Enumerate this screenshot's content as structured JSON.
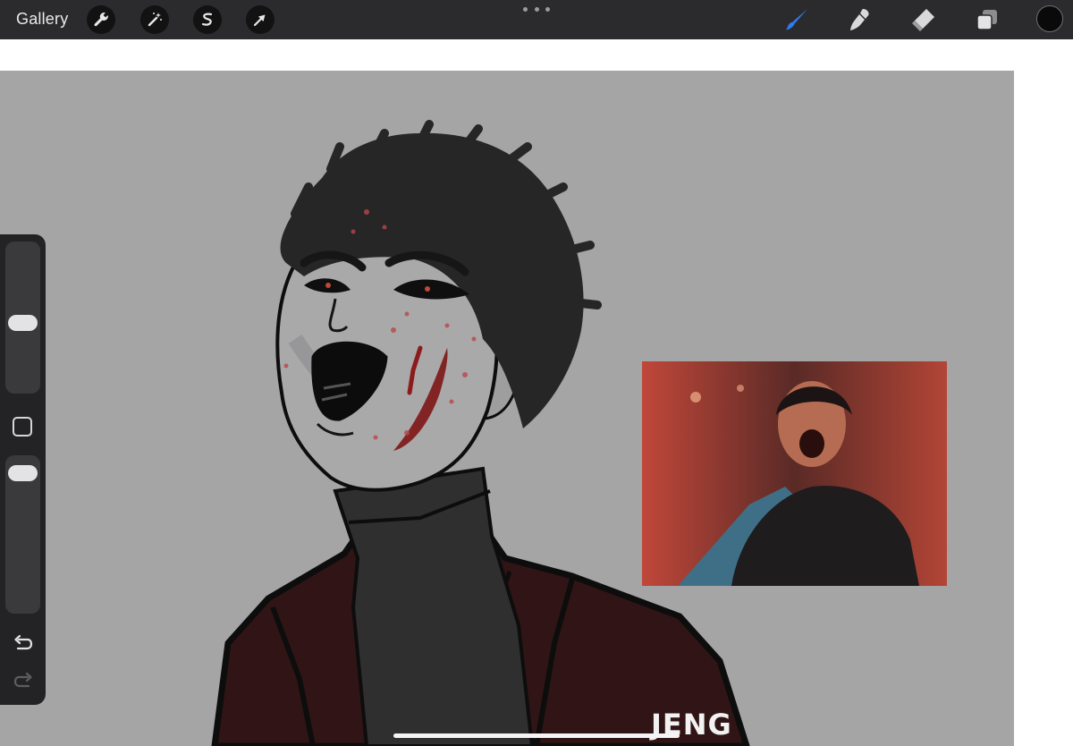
{
  "toolbar": {
    "gallery_label": "Gallery",
    "left_tools": [
      "wrench-icon",
      "magic-wand-icon",
      "selection-s-icon",
      "transform-arrow-icon"
    ],
    "right_tools": [
      "brush-icon",
      "smudge-icon",
      "eraser-icon",
      "layers-icon"
    ],
    "active_tool": "brush-icon",
    "accent_color": "#2f7bf5",
    "current_color": "#0a0a0a"
  },
  "sidebar": {
    "brush_size_level": 0.46,
    "opacity_level": 0.95
  },
  "canvas": {
    "background": "#a5a5a5",
    "signature": "JENG"
  },
  "reference": {
    "palette": [
      "#c0473a",
      "#3f6f86",
      "#1e1c1d"
    ]
  }
}
